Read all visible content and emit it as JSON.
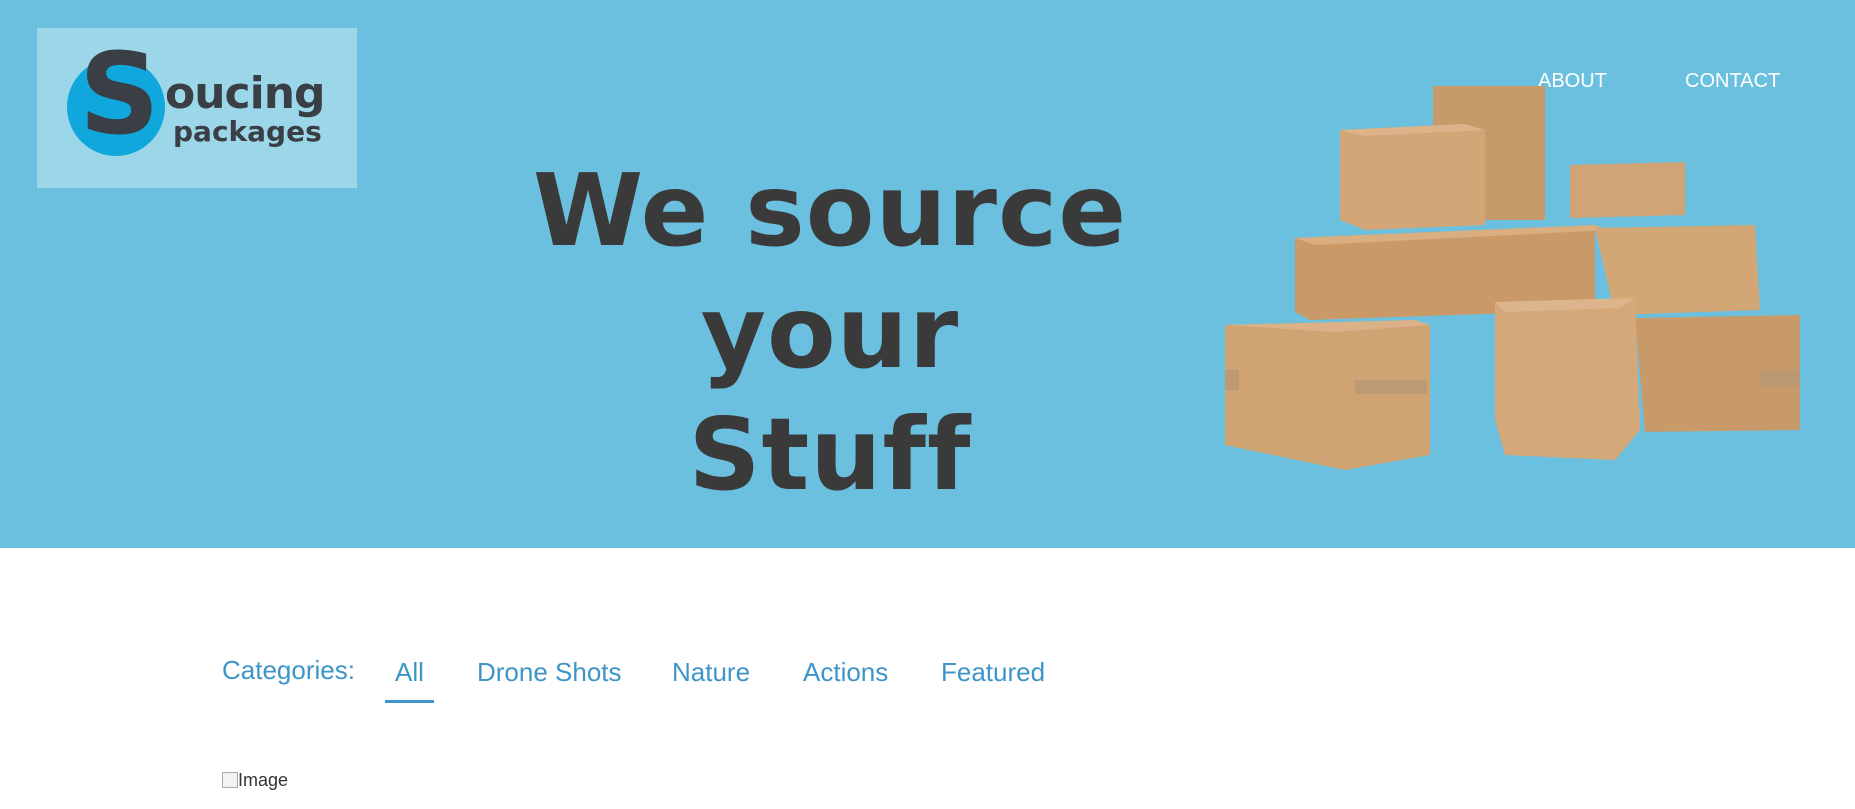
{
  "logo": {
    "letter": "S",
    "line1": "oucing",
    "line2": "packages",
    "accent_color": "#0fa7dc"
  },
  "nav": {
    "about": "ABOUT",
    "contact": "CONTACT"
  },
  "hero": {
    "headline_line1": "We source your",
    "headline_line2": "Stuff",
    "background_color": "#6cc0df",
    "image_icon": "cardboard-boxes-illustration"
  },
  "categories": {
    "label": "Categories:",
    "items": [
      "All",
      "Drone Shots",
      "Nature",
      "Actions",
      "Featured"
    ],
    "active": "All",
    "accent_color": "#3d95c9"
  },
  "gallery": {
    "broken_image_alt": "Image"
  }
}
